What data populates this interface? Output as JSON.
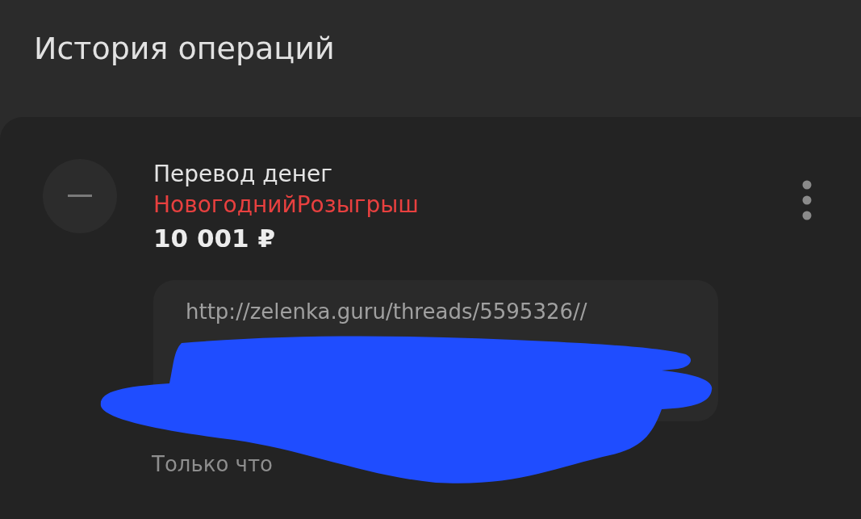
{
  "header": {
    "title": "История операций"
  },
  "operation": {
    "title": "Перевод денег",
    "recipient": "НовогоднийРозыгрыш",
    "amount": "10 001 ₽",
    "comment": "http://zelenka.guru/threads/5595326//",
    "time": "Только что"
  },
  "redaction": {
    "kind": "scribble",
    "color": "#1f4dff"
  }
}
